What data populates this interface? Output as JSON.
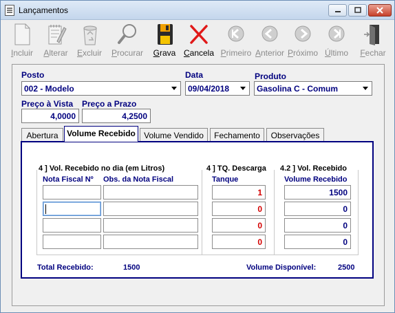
{
  "window": {
    "title": "Lançamentos",
    "icon": "notepad-icon"
  },
  "toolbar": {
    "buttons": [
      {
        "label": "Incluir",
        "icon": "new-document-icon",
        "enabled": false
      },
      {
        "label": "Alterar",
        "icon": "edit-notepad-icon",
        "enabled": false
      },
      {
        "label": "Excluir",
        "icon": "recycle-bin-icon",
        "enabled": false
      },
      {
        "label": "Procurar",
        "icon": "magnifier-icon",
        "enabled": false
      },
      {
        "label": "Grava",
        "icon": "floppy-disk-icon",
        "enabled": true
      },
      {
        "label": "Cancela",
        "icon": "red-x-icon",
        "enabled": true
      },
      {
        "label": "Primeiro",
        "icon": "first-record-icon",
        "enabled": false
      },
      {
        "label": "Anterior",
        "icon": "previous-record-icon",
        "enabled": false
      },
      {
        "label": "Próximo",
        "icon": "next-record-icon",
        "enabled": false
      },
      {
        "label": "Último",
        "icon": "last-record-icon",
        "enabled": false
      },
      {
        "label": "Fechar",
        "icon": "exit-door-icon",
        "enabled": false
      }
    ]
  },
  "form": {
    "posto": {
      "label": "Posto",
      "value": "002 - Modelo"
    },
    "data": {
      "label": "Data",
      "value": "09/04/2018"
    },
    "produto": {
      "label": "Produto",
      "value": "Gasolina C - Comum"
    },
    "preco_vista": {
      "label": "Preço à Vista",
      "value": "4,0000"
    },
    "preco_prazo": {
      "label": "Preço a Prazo",
      "value": "4,2500"
    }
  },
  "tabs": [
    {
      "label": "Abertura",
      "active": false
    },
    {
      "label": "Volume Recebido",
      "active": true
    },
    {
      "label": "Volume Vendido",
      "active": false
    },
    {
      "label": "Fechamento",
      "active": false
    },
    {
      "label": "Observações",
      "active": false
    }
  ],
  "volume_recebido": {
    "section1_heading": "4 ] Vol. Recebido no dia (em Litros)",
    "section2_heading": "4 ] TQ. Descarga",
    "section3_heading": "4.2 ] Vol. Recebido",
    "col_nota": "Nota Fiscal Nº",
    "col_obs": "Obs. da Nota Fiscal",
    "col_tanque": "Tanque",
    "col_volume": "Volume Recebido",
    "rows": [
      {
        "nota": "",
        "obs": "",
        "tanque": "1",
        "volume": "1500"
      },
      {
        "nota": "",
        "obs": "",
        "tanque": "0",
        "volume": "0"
      },
      {
        "nota": "",
        "obs": "",
        "tanque": "0",
        "volume": "0"
      },
      {
        "nota": "",
        "obs": "",
        "tanque": "0",
        "volume": "0"
      }
    ],
    "total_label": "Total Recebido:",
    "total_value": "1500",
    "disponivel_label": "Volume Disponível:",
    "disponivel_value": "2500"
  }
}
